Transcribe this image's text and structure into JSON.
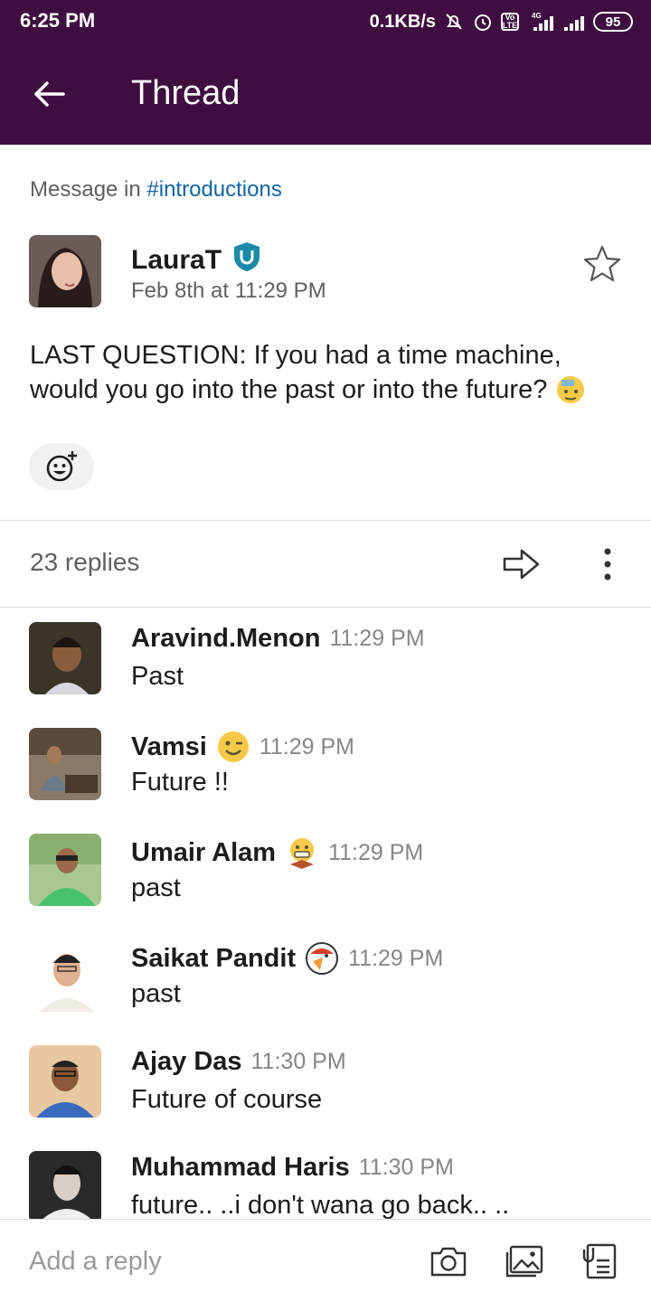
{
  "status_bar": {
    "time": "6:25 PM",
    "speed": "0.1KB/s",
    "volte": "Vo LTE",
    "network": "4G",
    "battery": "95"
  },
  "header": {
    "title": "Thread"
  },
  "parent": {
    "context_prefix": "Message in ",
    "channel": "#introductions",
    "author": "LauraT",
    "timestamp": "Feb 8th at 11:29 PM",
    "body": "LAST QUESTION: If you had a time machine, would you go into the past or into the future?",
    "body_emoji": "thinking-emoji"
  },
  "thread_bar": {
    "replies": "23 replies"
  },
  "replies": [
    {
      "name": "Aravind.Menon",
      "time": "11:29 PM",
      "text": "Past",
      "status_emoji": ""
    },
    {
      "name": "Vamsi",
      "time": "11:29 PM",
      "text": "Future !!",
      "status_emoji": "winking-face"
    },
    {
      "name": "Umair Alam",
      "time": "11:29 PM",
      "text": "past",
      "status_emoji": "grimacing-face"
    },
    {
      "name": "Saikat Pandit",
      "time": "11:29 PM",
      "text": "past",
      "status_emoji": "parrot-emoji"
    },
    {
      "name": "Ajay Das",
      "time": "11:30 PM",
      "text": "Future of course",
      "status_emoji": ""
    },
    {
      "name": "Muhammad Haris",
      "time": "11:30 PM",
      "text": "future.. ..i don't wana go back.. ..",
      "status_emoji": ""
    }
  ],
  "composer": {
    "placeholder": "Add a reply"
  },
  "colors": {
    "aubergine": "#3f0e40",
    "link": "#1264a3",
    "muted": "#616061"
  }
}
